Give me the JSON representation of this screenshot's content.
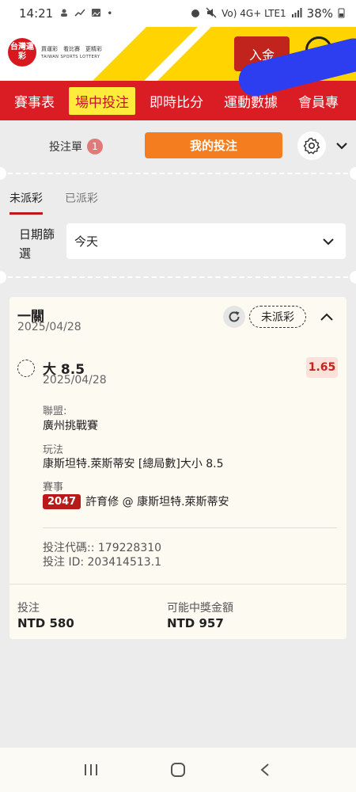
{
  "status_bar": {
    "time": "14:21",
    "network": "Vo) 4G+ LTE1",
    "battery": "38%"
  },
  "header": {
    "logo_badge": "台灣運彩",
    "logo_line1": "買運彩　看比賽　更精彩",
    "logo_line2": "TAIWAN SPORTS LOTTERY",
    "deposit_label": "入金",
    "brand_color": "#da1c25",
    "accent_yellow": "#ffd400"
  },
  "nav": {
    "items": [
      {
        "label": "賽事表",
        "active": false
      },
      {
        "label": "場中投注",
        "active": true
      },
      {
        "label": "即時比分",
        "active": false
      },
      {
        "label": "運動數據",
        "active": false
      },
      {
        "label": "會員專",
        "active": false
      }
    ]
  },
  "slip": {
    "tab_label": "投注單",
    "count": "1",
    "my_bets_label": "我的投注",
    "settings_icon": "gear-icon",
    "collapse_icon": "chevron-down-icon"
  },
  "subtabs": [
    {
      "label": "未派彩",
      "active": true
    },
    {
      "label": "已派彩",
      "active": false
    }
  ],
  "filter": {
    "label": "日期篩選",
    "value": "今天"
  },
  "bet": {
    "type": "一關",
    "date": "2025/04/28",
    "status": "未派彩",
    "selection": {
      "name": "大 8.5",
      "date": "2025/04/28",
      "odds": "1.65"
    },
    "league_label": "聯盟:",
    "league": "廣州挑戰賽",
    "market_label": "玩法",
    "market": "康斯坦特.萊斯蒂安 [總局數]大小 8.5",
    "event_label": "賽事",
    "event_id": "2047",
    "event_name": "許育修 @ 康斯坦特.萊斯蒂安",
    "bet_code": "投注代碼:: 179228310",
    "bet_id": "投注 ID: 203414513.1",
    "stake_label": "投注",
    "stake_value": "NTD 580",
    "payout_label": "可能中獎金額",
    "payout_value": "NTD 957"
  }
}
